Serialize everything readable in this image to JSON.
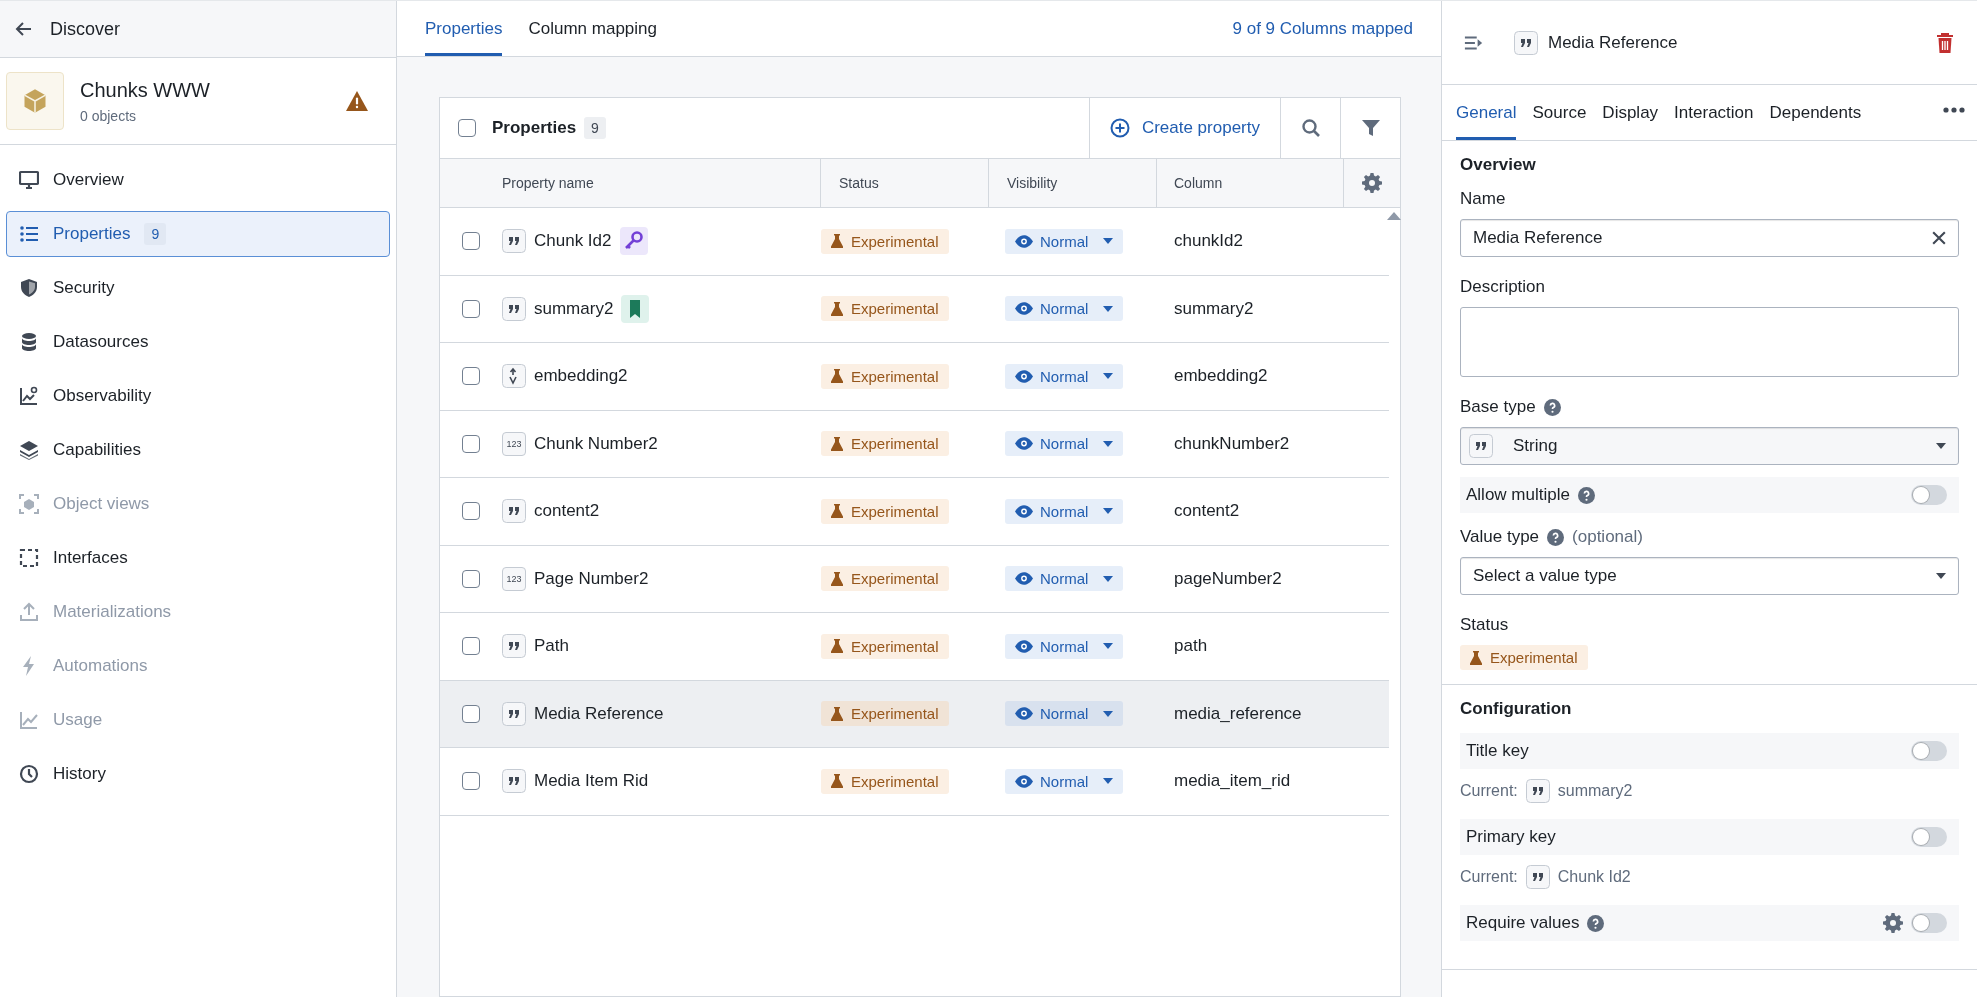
{
  "sidebar": {
    "back_label": "Discover",
    "object": {
      "name": "Chunks WWW",
      "count": "0 objects",
      "warning": true
    },
    "items": [
      {
        "label": "Overview",
        "selected": false,
        "disabled": false
      },
      {
        "label": "Properties",
        "badge": "9",
        "selected": true,
        "disabled": false
      },
      {
        "label": "Security",
        "selected": false,
        "disabled": false
      },
      {
        "label": "Datasources",
        "selected": false,
        "disabled": false
      },
      {
        "label": "Observability",
        "selected": false,
        "disabled": false
      },
      {
        "label": "Capabilities",
        "selected": false,
        "disabled": false
      },
      {
        "label": "Object views",
        "selected": false,
        "disabled": true
      },
      {
        "label": "Interfaces",
        "selected": false,
        "disabled": false
      },
      {
        "label": "Materializations",
        "selected": false,
        "disabled": true
      },
      {
        "label": "Automations",
        "selected": false,
        "disabled": true
      },
      {
        "label": "Usage",
        "selected": false,
        "disabled": true
      },
      {
        "label": "History",
        "selected": false,
        "disabled": false
      }
    ]
  },
  "main": {
    "tabs": [
      {
        "label": "Properties",
        "selected": true
      },
      {
        "label": "Column mapping",
        "selected": false
      }
    ],
    "mapped": "9 of 9 Columns mapped",
    "table": {
      "title": "Properties",
      "count": "9",
      "create_label": "Create property",
      "all_checked": false,
      "columns": [
        "Property name",
        "Status",
        "Visibility",
        "Column"
      ],
      "rows": [
        {
          "kind": "string",
          "name": "Chunk Id2",
          "primary_key": true,
          "title_key": false,
          "status": "Experimental",
          "visibility": "Normal",
          "column": "chunkId2",
          "checked": false,
          "selected": false
        },
        {
          "kind": "string",
          "name": "summary2",
          "primary_key": false,
          "title_key": true,
          "status": "Experimental",
          "visibility": "Normal",
          "column": "summary2",
          "checked": false,
          "selected": false
        },
        {
          "kind": "vector",
          "name": "embedding2",
          "primary_key": false,
          "title_key": false,
          "status": "Experimental",
          "visibility": "Normal",
          "column": "embedding2",
          "checked": false,
          "selected": false
        },
        {
          "kind": "number",
          "type_label": "123",
          "name": "Chunk Number2",
          "primary_key": false,
          "title_key": false,
          "status": "Experimental",
          "visibility": "Normal",
          "column": "chunkNumber2",
          "checked": false,
          "selected": false
        },
        {
          "kind": "string",
          "name": "content2",
          "primary_key": false,
          "title_key": false,
          "status": "Experimental",
          "visibility": "Normal",
          "column": "content2",
          "checked": false,
          "selected": false
        },
        {
          "kind": "number",
          "type_label": "123",
          "name": "Page Number2",
          "primary_key": false,
          "title_key": false,
          "status": "Experimental",
          "visibility": "Normal",
          "column": "pageNumber2",
          "checked": false,
          "selected": false
        },
        {
          "kind": "string",
          "name": "Path",
          "primary_key": false,
          "title_key": false,
          "status": "Experimental",
          "visibility": "Normal",
          "column": "path",
          "checked": false,
          "selected": false
        },
        {
          "kind": "string",
          "name": "Media Reference",
          "primary_key": false,
          "title_key": false,
          "status": "Experimental",
          "visibility": "Normal",
          "column": "media_reference",
          "checked": false,
          "selected": true
        },
        {
          "kind": "string",
          "name": "Media Item Rid",
          "primary_key": false,
          "title_key": false,
          "status": "Experimental",
          "visibility": "Normal",
          "column": "media_item_rid",
          "checked": false,
          "selected": false
        }
      ]
    }
  },
  "panel": {
    "title": "Media Reference",
    "tabs": [
      {
        "label": "General",
        "selected": true
      },
      {
        "label": "Source",
        "selected": false
      },
      {
        "label": "Display",
        "selected": false
      },
      {
        "label": "Interaction",
        "selected": false
      },
      {
        "label": "Dependents",
        "selected": false
      }
    ],
    "overview_heading": "Overview",
    "name_label": "Name",
    "name_value": "Media Reference",
    "description_label": "Description",
    "base_type_label": "Base type",
    "base_type_value": "String",
    "allow_multiple": {
      "label": "Allow multiple",
      "on": false
    },
    "value_type_label": "Value type",
    "value_type_optional": "(optional)",
    "value_type_placeholder": "Select a value type",
    "status_label": "Status",
    "status_value": "Experimental",
    "configuration_heading": "Configuration",
    "config": [
      {
        "label": "Title key",
        "on": false,
        "current_label": "Current:",
        "current_value": "summary2"
      },
      {
        "label": "Primary key",
        "on": false,
        "current_label": "Current:",
        "current_value": "Chunk Id2"
      },
      {
        "label": "Require values",
        "on": false,
        "help": true,
        "settings": true
      }
    ]
  }
}
